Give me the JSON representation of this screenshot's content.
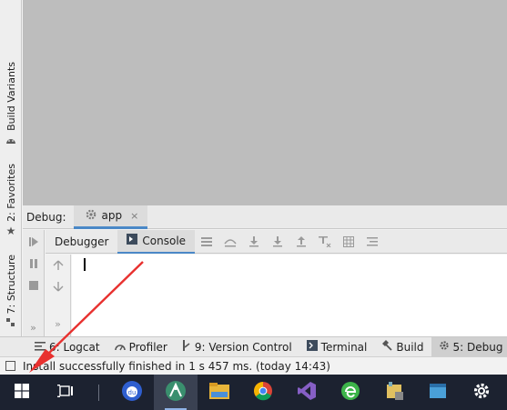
{
  "left_strip": {
    "build_variants": "Build Variants",
    "favorites": "2: Favorites",
    "structure": "7: Structure"
  },
  "debug": {
    "title": "Debug:",
    "tab_label": "app",
    "close_glyph": "×"
  },
  "subtabs": {
    "debugger": "Debugger",
    "console": "Console"
  },
  "bottom_tabs": [
    {
      "label": "6: Logcat"
    },
    {
      "label": "Profiler"
    },
    {
      "label": "9: Version Control"
    },
    {
      "label": "Terminal"
    },
    {
      "label": "Build"
    },
    {
      "label": "5: Debug"
    }
  ],
  "status": {
    "message": "Install successfully finished in 1 s 457 ms. (today 14:43)"
  },
  "taskbar": {
    "icons": [
      "windows-start-icon",
      "task-view-icon",
      "baidu-icon",
      "android-studio-icon",
      "file-explorer-icon",
      "chrome-icon",
      "visual-studio-icon",
      "edge-icon",
      "app-icon",
      "settings-icon"
    ]
  },
  "colors": {
    "accent": "#4a88c7",
    "taskbar": "#1c2230",
    "editor_bg": "#bdbdbd"
  }
}
